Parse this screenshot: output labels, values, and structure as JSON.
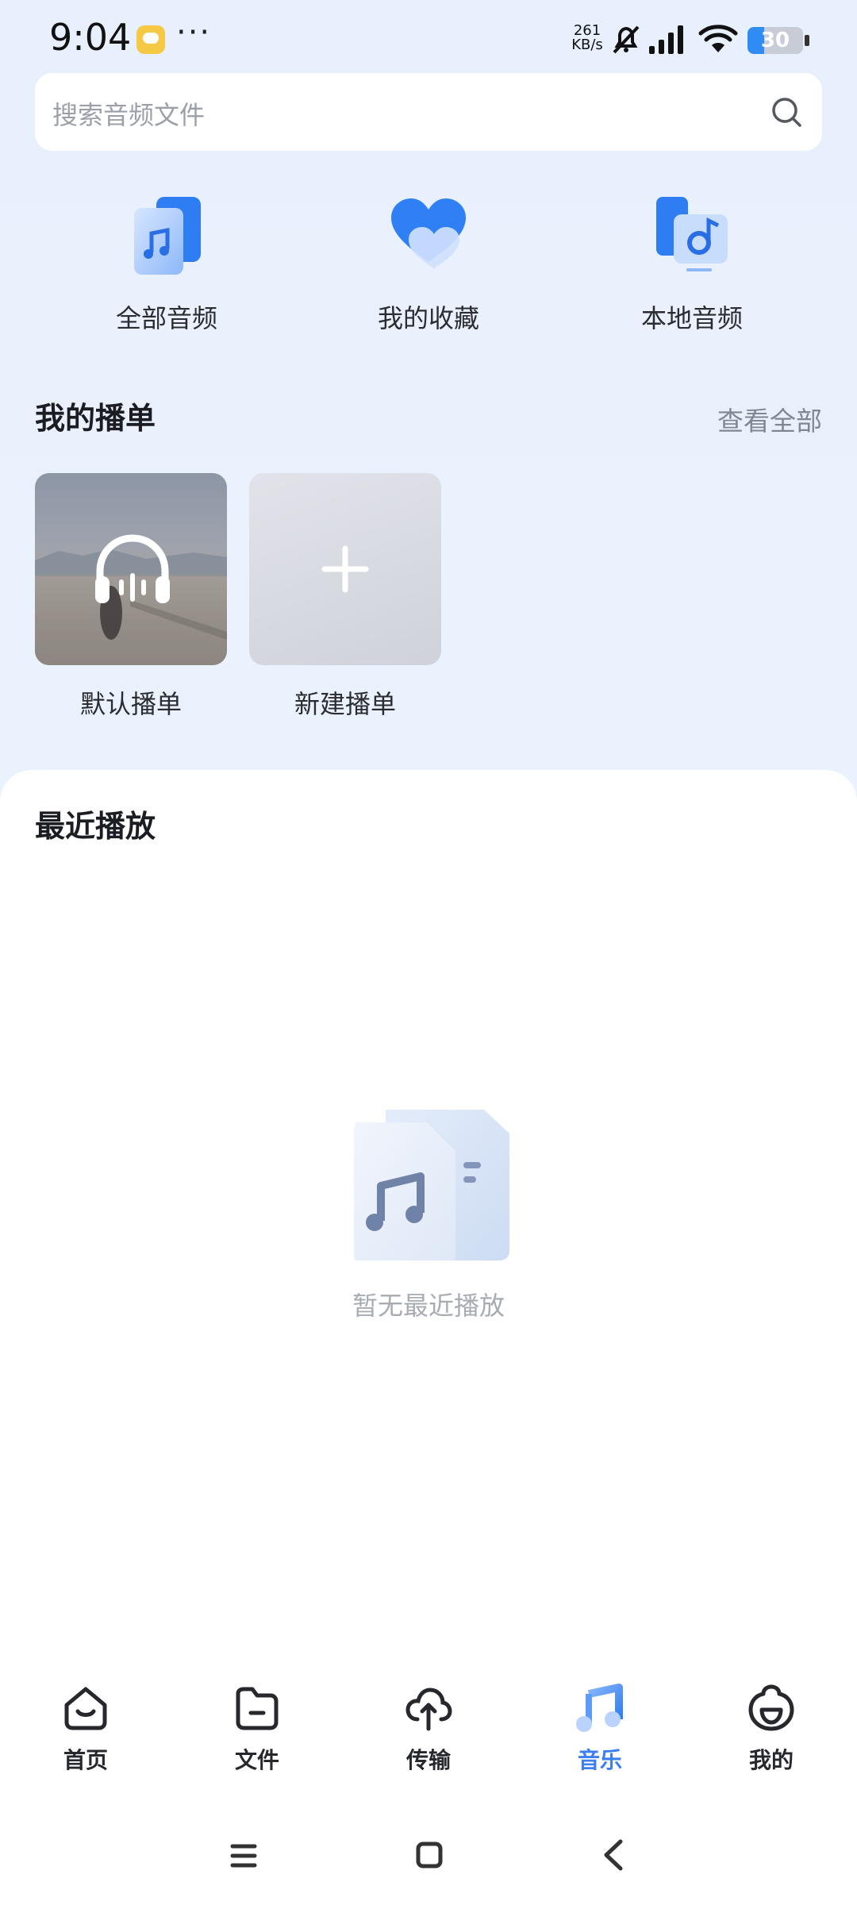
{
  "status_bar": {
    "time": "9:04",
    "net_speed_value": "261",
    "net_speed_unit": "KB/s",
    "battery_level": "30",
    "battery_fraction": 0.3
  },
  "search": {
    "placeholder": "搜索音频文件"
  },
  "categories": [
    {
      "label": "全部音频",
      "icon": "audio-files-icon"
    },
    {
      "label": "我的收藏",
      "icon": "heart-icon"
    },
    {
      "label": "本地音频",
      "icon": "local-audio-icon"
    }
  ],
  "playlists_section": {
    "title": "我的播单",
    "see_all": "查看全部",
    "items": [
      {
        "label": "默认播单",
        "icon": "headphones-icon"
      },
      {
        "label": "新建播单",
        "icon": "plus-icon"
      }
    ]
  },
  "recent": {
    "title": "最近播放",
    "empty_text": "暂无最近播放"
  },
  "bottom_nav": [
    {
      "label": "首页",
      "icon": "home-icon",
      "active": false
    },
    {
      "label": "文件",
      "icon": "folder-icon",
      "active": false
    },
    {
      "label": "传输",
      "icon": "cloud-transfer-icon",
      "active": false
    },
    {
      "label": "音乐",
      "icon": "music-icon",
      "active": true
    },
    {
      "label": "我的",
      "icon": "profile-icon",
      "active": false
    }
  ],
  "colors": {
    "accent": "#3b7ff2",
    "background": "#eaf2fd",
    "text": "#1d1f24",
    "muted": "#a7acb3"
  }
}
